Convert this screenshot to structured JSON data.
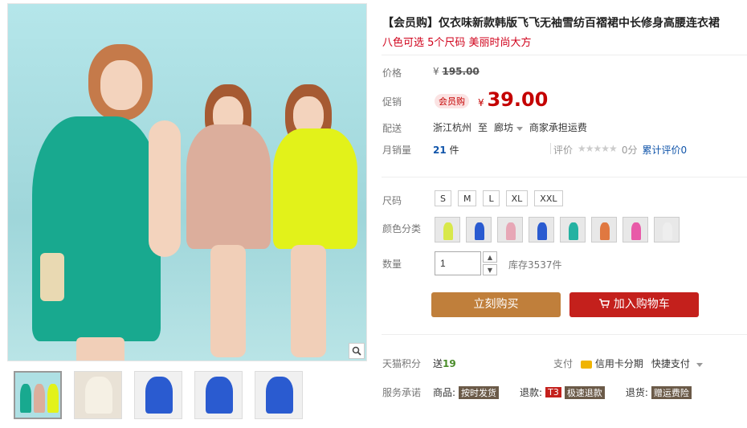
{
  "title": "【会员购】仅衣味新款韩版飞飞无袖雪纺百褶裙中长修身高腰连衣裙",
  "subtitle": "八色可选 5个尺码 美丽时尚大方",
  "price": {
    "label": "价格",
    "currency": "¥",
    "original": "195.00",
    "promo_label": "促销",
    "member_tag": "会员购",
    "promo_price": "39.00"
  },
  "shipping": {
    "label": "配送",
    "from": "浙江杭州",
    "to_word": "至",
    "to": "廊坊",
    "note": "商家承担运费"
  },
  "sales": {
    "label": "月销量",
    "count": "21",
    "unit": "件",
    "review_label": "评价",
    "stars": "★★★★★",
    "score": "0分",
    "total_reviews": "累计评价0"
  },
  "size": {
    "label": "尺码",
    "options": [
      "S",
      "M",
      "L",
      "XL",
      "XXL"
    ]
  },
  "color": {
    "label": "颜色分类",
    "swatches": [
      "#d8e84a",
      "#2a5bd0",
      "#e7a7b6",
      "#2a5bd0",
      "#24b2a2",
      "#e07840",
      "#e85aa8",
      "#eeeeee"
    ]
  },
  "quantity": {
    "label": "数量",
    "value": "1",
    "stock": "库存3537件"
  },
  "buttons": {
    "buy_now": "立刻购买",
    "add_to_cart": "加入购物车"
  },
  "points": {
    "label": "天猫积分",
    "prefix": "送",
    "value": "19"
  },
  "payment": {
    "label": "支付",
    "card": "信用卡分期",
    "quick": "快捷支付"
  },
  "promise": {
    "label": "服务承诺",
    "goods": "商品:",
    "goods_tag": "按时发货",
    "refund": "退款:",
    "refund_tag_1": "T3",
    "refund_tag_2": "极速退款",
    "return": "退货:",
    "return_tag": "赠运费险"
  },
  "thumbnails": [
    {
      "bg": "#aee0e4",
      "figs": [
        "#18a98f",
        "#dcae9c",
        "#e2f21a"
      ]
    },
    {
      "bg": "#e9e2d6",
      "figs": [
        "#f5f0e4"
      ]
    },
    {
      "bg": "#f0f0f0",
      "figs": [
        "#2a5bd0"
      ]
    },
    {
      "bg": "#f0f0f0",
      "figs": [
        "#2a5bd0"
      ]
    },
    {
      "bg": "#f0f0f0",
      "figs": [
        "#2a5bd0"
      ]
    }
  ]
}
